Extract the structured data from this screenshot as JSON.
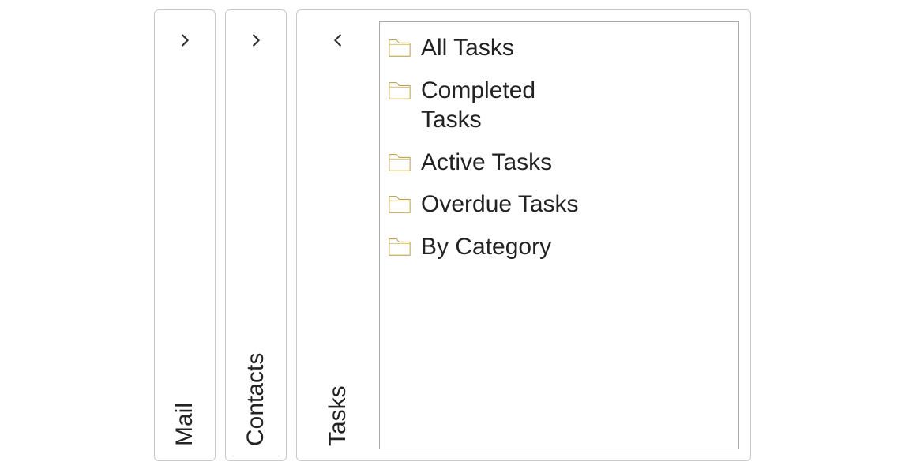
{
  "panels": {
    "mail": {
      "label": "Mail"
    },
    "contacts": {
      "label": "Contacts"
    },
    "tasks": {
      "label": "Tasks"
    }
  },
  "taskFolders": [
    {
      "label": "All Tasks"
    },
    {
      "label": "Completed Tasks"
    },
    {
      "label": "Active Tasks"
    },
    {
      "label": "Overdue Tasks"
    },
    {
      "label": "By Category"
    }
  ]
}
